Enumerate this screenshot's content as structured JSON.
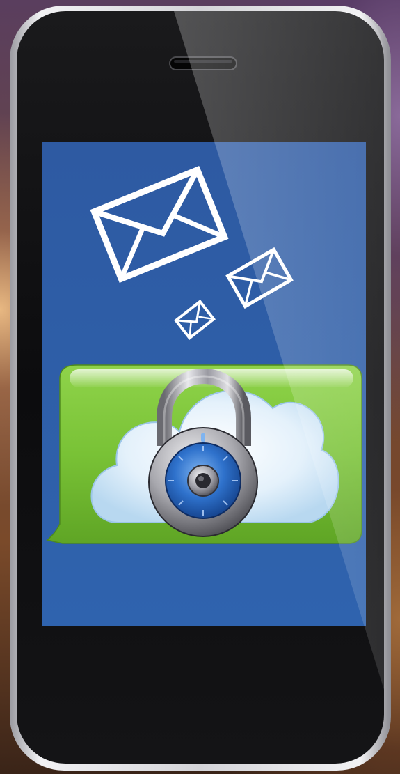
{
  "scene": {
    "colors": {
      "phone_frame": "#0e0e10",
      "phone_bezel": "#c9c9cc",
      "screen_blue": "#2f5ea8",
      "bubble_green": "#7cc43a",
      "cloud_light": "#e6f2fb",
      "lock_dial_blue": "#2e72c9"
    },
    "icons": {
      "large_envelope": "envelope-icon",
      "medium_envelope": "envelope-icon",
      "small_envelope": "envelope-icon",
      "cloud": "cloud-icon",
      "padlock": "padlock-icon",
      "speaker": "speaker-slot-icon"
    }
  }
}
